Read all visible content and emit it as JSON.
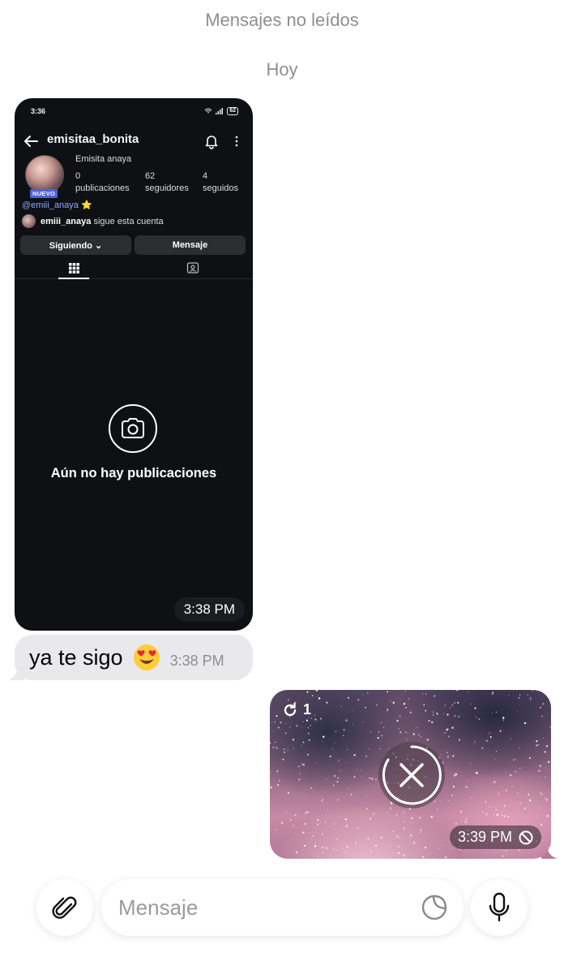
{
  "chat": {
    "unread_label": "Mensajes no leídos",
    "date_label": "Hoy"
  },
  "screenshot": {
    "status_time": "3:36",
    "battery": "62",
    "username": "emisitaa_bonita",
    "new_badge": "NUEVO",
    "display_name": "Emisita anaya",
    "stats": [
      {
        "value": "0",
        "label": "publicaciones"
      },
      {
        "value": "62",
        "label": "seguidores"
      },
      {
        "value": "4",
        "label": "seguidos"
      }
    ],
    "handle": "@emiii_anaya",
    "handle_emoji": "⭐",
    "followed_by_user": "emiii_anaya",
    "followed_by_text": "sigue esta cuenta",
    "following_button": "Siguiendo ⌄",
    "message_button": "Mensaje",
    "empty_text": "Aún no hay publicaciones",
    "time": "3:38 PM"
  },
  "incoming_message": {
    "text": "ya te sigo",
    "emoji": "heart-eyes-emoji",
    "time": "3:38 PM"
  },
  "outgoing_media": {
    "replay_count": "1",
    "time": "3:39 PM"
  },
  "composer": {
    "placeholder": "Mensaje"
  },
  "icons": {
    "attach": "paperclip-icon",
    "sticker": "sticker-icon",
    "mic": "microphone-icon"
  },
  "colors": {
    "incoming_bubble": "#e9e9eb",
    "handle_link": "#8ba7ff",
    "new_badge": "#4c62d8"
  }
}
